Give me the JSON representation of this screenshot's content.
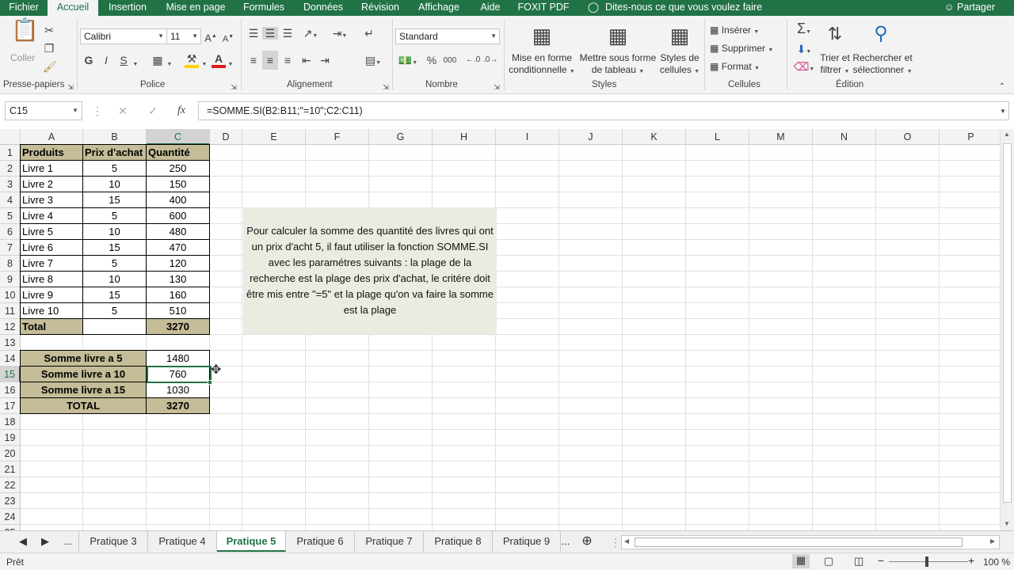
{
  "menu": {
    "tabs": [
      "Fichier",
      "Accueil",
      "Insertion",
      "Mise en page",
      "Formules",
      "Données",
      "Révision",
      "Affichage",
      "Aide",
      "FOXIT PDF"
    ],
    "tell_me": "Dites-nous ce que vous voulez faire",
    "share": "Partager"
  },
  "ribbon": {
    "clipboard": {
      "paste": "Coller",
      "group": "Presse-papiers"
    },
    "font": {
      "name": "Calibri",
      "size": "11",
      "bold": "G",
      "italic": "I",
      "underline": "S",
      "group": "Police"
    },
    "alignment": {
      "group": "Alignement"
    },
    "number": {
      "format": "Standard",
      "percent": "%",
      "thousands": "000",
      "group": "Nombre"
    },
    "styles": {
      "conditional_1": "Mise en forme",
      "conditional_2": "conditionnelle",
      "table_1": "Mettre sous forme",
      "table_2": "de tableau",
      "cell_styles_1": "Styles de",
      "cell_styles_2": "cellules",
      "group": "Styles"
    },
    "cells": {
      "insert": "Insérer",
      "delete": "Supprimer",
      "format": "Format",
      "group": "Cellules"
    },
    "editing": {
      "sort_1": "Trier et",
      "sort_2": "filtrer",
      "find_1": "Rechercher et",
      "find_2": "sélectionner",
      "group": "Édition"
    }
  },
  "formula_bar": {
    "name_box": "C15",
    "fx": "fx",
    "formula": "=SOMME.SI(B2:B11;\"=10\";C2:C11)"
  },
  "columns": [
    "A",
    "B",
    "C",
    "D",
    "E",
    "F",
    "G",
    "H",
    "I",
    "J",
    "K",
    "L",
    "M",
    "N",
    "O",
    "P"
  ],
  "rows": [
    "1",
    "2",
    "3",
    "4",
    "5",
    "6",
    "7",
    "8",
    "9",
    "10",
    "11",
    "12",
    "13",
    "14",
    "15",
    "16",
    "17",
    "18",
    "19",
    "20",
    "21",
    "22",
    "23",
    "24",
    "25"
  ],
  "table": {
    "headers": [
      "Produits",
      "Prix d'achat",
      "Quantité"
    ],
    "items": [
      [
        "Livre 1",
        "5",
        "250"
      ],
      [
        "Livre 2",
        "10",
        "150"
      ],
      [
        "Livre 3",
        "15",
        "400"
      ],
      [
        "Livre 4",
        "5",
        "600"
      ],
      [
        "Livre 5",
        "10",
        "480"
      ],
      [
        "Livre 6",
        "15",
        "470"
      ],
      [
        "Livre 7",
        "5",
        "120"
      ],
      [
        "Livre 8",
        "10",
        "130"
      ],
      [
        "Livre 9",
        "15",
        "160"
      ],
      [
        "Livre 10",
        "5",
        "510"
      ]
    ],
    "total_label": "Total",
    "total_value": "3270"
  },
  "summary": [
    [
      "Somme livre a 5",
      "1480"
    ],
    [
      "Somme livre a 10",
      "760"
    ],
    [
      "Somme livre a 15",
      "1030"
    ],
    [
      "TOTAL",
      "3270"
    ]
  ],
  "note": "Pour calculer la somme des quantité des livres qui ont un prix d'acht 5, il faut utiliser la fonction SOMME.SI avec les paramétres suivants : la plage de la recherche est la plage des prix d'achat, le critére doit être mis entre \"=5\" et la plage qu'on va faire la somme est la plage",
  "sheets": {
    "more": "...",
    "tabs": [
      "Pratique 3",
      "Pratique 4",
      "Pratique 5",
      "Pratique 6",
      "Pratique 7",
      "Pratique 8",
      "Pratique 9"
    ],
    "active": "Pratique 5"
  },
  "status": {
    "ready": "Prêt",
    "zoom": "100 %"
  },
  "colors": {
    "accent": "#217346",
    "header_fill": "#c4bd97",
    "note_fill": "#ebebe1"
  }
}
